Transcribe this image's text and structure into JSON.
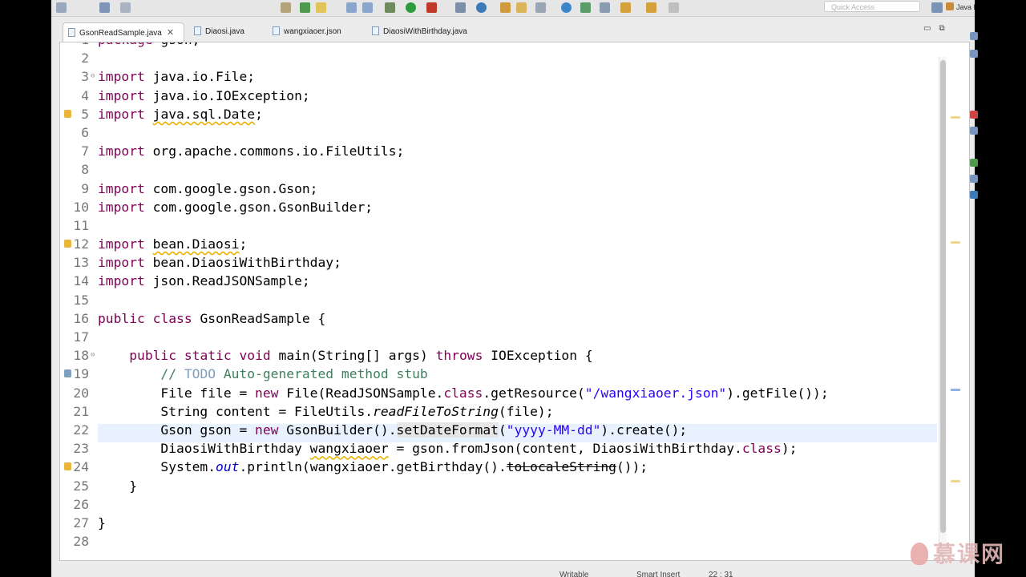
{
  "toolbar": {
    "quick_access_placeholder": "Quick Access",
    "perspective_label": "Java EE"
  },
  "tabs": [
    {
      "label": "GsonReadSample.java",
      "active": true
    },
    {
      "label": "Diaosi.java",
      "active": false
    },
    {
      "label": "wangxiaoer.json",
      "active": false
    },
    {
      "label": "DiaosiWithBirthday.java",
      "active": false
    }
  ],
  "editor": {
    "current_line": "22",
    "lines": [
      {
        "num": "1",
        "text": "package gson;"
      },
      {
        "num": "2",
        "text": ""
      },
      {
        "num": "3",
        "text": "import java.io.File;"
      },
      {
        "num": "4",
        "text": "import java.io.IOException;"
      },
      {
        "num": "5",
        "text": "import java.sql.Date;"
      },
      {
        "num": "6",
        "text": ""
      },
      {
        "num": "7",
        "text": "import org.apache.commons.io.FileUtils;"
      },
      {
        "num": "8",
        "text": ""
      },
      {
        "num": "9",
        "text": "import com.google.gson.Gson;"
      },
      {
        "num": "10",
        "text": "import com.google.gson.GsonBuilder;"
      },
      {
        "num": "11",
        "text": ""
      },
      {
        "num": "12",
        "text": "import bean.Diaosi;"
      },
      {
        "num": "13",
        "text": "import bean.DiaosiWithBirthday;"
      },
      {
        "num": "14",
        "text": "import json.ReadJSONSample;"
      },
      {
        "num": "15",
        "text": ""
      },
      {
        "num": "16",
        "text": "public class GsonReadSample {"
      },
      {
        "num": "17",
        "text": ""
      },
      {
        "num": "18",
        "text": "    public static void main(String[] args) throws IOException {"
      },
      {
        "num": "19",
        "text": "        // TODO Auto-generated method stub"
      },
      {
        "num": "20",
        "text": "        File file = new File(ReadJSONSample.class.getResource(\"/wangxiaoer.json\").getFile());"
      },
      {
        "num": "21",
        "text": "        String content = FileUtils.readFileToString(file);"
      },
      {
        "num": "22",
        "text": "        Gson gson = new GsonBuilder().setDateFormat(\"yyyy-MM-dd\").create();"
      },
      {
        "num": "23",
        "text": "        DiaosiWithBirthday wangxiaoer = gson.fromJson(content, DiaosiWithBirthday.class);"
      },
      {
        "num": "24",
        "text": "        System.out.println(wangxiaoer.getBirthday().toLocaleString());"
      },
      {
        "num": "25",
        "text": "    }"
      },
      {
        "num": "26",
        "text": ""
      },
      {
        "num": "27",
        "text": "}"
      },
      {
        "num": "28",
        "text": ""
      }
    ]
  },
  "statusbar": {
    "writable": "Writable",
    "insert_mode": "Smart Insert",
    "position": "22 : 31"
  },
  "watermark": {
    "text": "慕课网"
  },
  "colors": {
    "keyword": "#7f0055",
    "string": "#2a00ff",
    "comment": "#3f7f5f",
    "current_line_bg": "#e8f2fe",
    "warning": "#e7b300"
  }
}
